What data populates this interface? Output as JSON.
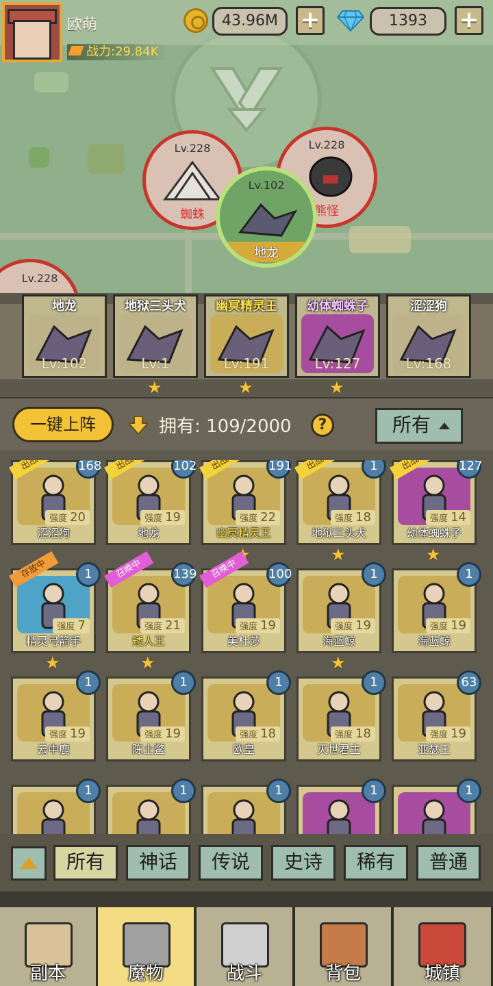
{
  "player": {
    "name": "欧萌",
    "power": "战力:29.84K"
  },
  "resources": {
    "gold": "43.96M",
    "gems": "1393",
    "plus": "+"
  },
  "map_nodes": [
    {
      "level": "Lv.228",
      "name": "蜘蛛",
      "state": "boss"
    },
    {
      "level": "Lv.228",
      "name": "熊怪",
      "state": "boss"
    },
    {
      "level": "Lv.102",
      "name": "地龙",
      "state": "current"
    },
    {
      "level": "Lv.228",
      "name": "",
      "state": "boss"
    }
  ],
  "squad": [
    {
      "name": "地龙",
      "level": "Lv:102",
      "stars": 0,
      "color": "#bdb28a"
    },
    {
      "name": "地狱三头犬",
      "level": "Lv:1",
      "stars": 1,
      "color": "#bdb28a"
    },
    {
      "name": "幽冥精灵王",
      "level": "Lv:191",
      "stars": 1,
      "color": "#c9ad58"
    },
    {
      "name": "幼体蜘蛛子",
      "level": "Lv:127",
      "stars": 1,
      "color": "#a74da0"
    },
    {
      "name": "涩涩狗",
      "level": "Lv:168",
      "stars": 0,
      "color": "#bdb28a"
    }
  ],
  "roster": {
    "deploy_label": "一键上阵",
    "own_label": "拥有: 109/2000",
    "help": "?",
    "filter_label": "所有",
    "power_prefix": "强度"
  },
  "cards": [
    {
      "name": "涩涩狗",
      "count": "168",
      "power": "20",
      "tag": "出战中",
      "tagColor": "yellow",
      "bg": "",
      "stars": 0,
      "gold": false
    },
    {
      "name": "地龙",
      "count": "102",
      "power": "19",
      "tag": "出战中",
      "tagColor": "yellow",
      "bg": "",
      "stars": 0,
      "gold": false
    },
    {
      "name": "幽冥精灵王",
      "count": "191",
      "power": "22",
      "tag": "出战中",
      "tagColor": "yellow",
      "bg": "",
      "stars": 1,
      "gold": true
    },
    {
      "name": "地狱三头犬",
      "count": "1",
      "power": "18",
      "tag": "出战中",
      "tagColor": "yellow",
      "bg": "",
      "stars": 1,
      "gold": false
    },
    {
      "name": "幼体蜘蛛子",
      "count": "127",
      "power": "14",
      "tag": "出战中",
      "tagColor": "yellow",
      "bg": "purple",
      "stars": 1,
      "gold": false
    },
    {
      "name": "精灵弓箭手",
      "count": "1",
      "power": "7",
      "tag": "存放中",
      "tagColor": "orange",
      "bg": "blue",
      "stars": 1,
      "gold": false
    },
    {
      "name": "矮人王",
      "count": "139",
      "power": "21",
      "tag": "召唤中",
      "tagColor": "pink",
      "bg": "",
      "stars": 1,
      "gold": true
    },
    {
      "name": "美杜莎",
      "count": "100",
      "power": "19",
      "tag": "召唤中",
      "tagColor": "pink",
      "bg": "",
      "stars": 0,
      "gold": false
    },
    {
      "name": "海蓝鲸",
      "count": "1",
      "power": "19",
      "tag": "",
      "tagColor": "",
      "bg": "",
      "stars": 1,
      "gold": false
    },
    {
      "name": "海蓝鲸",
      "count": "1",
      "power": "19",
      "tag": "",
      "tagColor": "",
      "bg": "",
      "stars": 0,
      "gold": false
    },
    {
      "name": "云中鹿",
      "count": "1",
      "power": "19",
      "tag": "",
      "tagColor": "",
      "bg": "",
      "stars": 0,
      "gold": false
    },
    {
      "name": "陈土鳖",
      "count": "1",
      "power": "19",
      "tag": "",
      "tagColor": "",
      "bg": "",
      "stars": 0,
      "gold": false
    },
    {
      "name": "欧皇",
      "count": "1",
      "power": "18",
      "tag": "",
      "tagColor": "",
      "bg": "",
      "stars": 0,
      "gold": false
    },
    {
      "name": "灭世君主",
      "count": "1",
      "power": "18",
      "tag": "",
      "tagColor": "",
      "bg": "",
      "stars": 0,
      "gold": false
    },
    {
      "name": "亚瑟王",
      "count": "63",
      "power": "19",
      "tag": "",
      "tagColor": "",
      "bg": "",
      "stars": 0,
      "gold": false
    },
    {
      "name": "",
      "count": "1",
      "power": "",
      "tag": "",
      "tagColor": "",
      "bg": "",
      "stars": 0,
      "gold": false
    },
    {
      "name": "",
      "count": "1",
      "power": "",
      "tag": "",
      "tagColor": "",
      "bg": "",
      "stars": 0,
      "gold": false
    },
    {
      "name": "",
      "count": "1",
      "power": "",
      "tag": "",
      "tagColor": "",
      "bg": "",
      "stars": 0,
      "gold": false
    },
    {
      "name": "",
      "count": "1",
      "power": "",
      "tag": "",
      "tagColor": "",
      "bg": "purple",
      "stars": 0,
      "gold": false
    },
    {
      "name": "",
      "count": "1",
      "power": "",
      "tag": "",
      "tagColor": "",
      "bg": "purple",
      "stars": 0,
      "gold": false
    }
  ],
  "rarity_filters": [
    {
      "label": "所有",
      "active": true
    },
    {
      "label": "神话",
      "active": false
    },
    {
      "label": "传说",
      "active": false
    },
    {
      "label": "史诗",
      "active": false
    },
    {
      "label": "稀有",
      "active": false
    },
    {
      "label": "普通",
      "active": false
    }
  ],
  "nav": [
    {
      "label": "副本",
      "icon": "map-scroll-icon",
      "active": false
    },
    {
      "label": "魔物",
      "icon": "monster-helmet-icon",
      "active": true
    },
    {
      "label": "战斗",
      "icon": "crossed-swords-icon",
      "active": false
    },
    {
      "label": "背包",
      "icon": "backpack-icon",
      "active": false
    },
    {
      "label": "城镇",
      "icon": "town-shop-icon",
      "active": false
    }
  ]
}
